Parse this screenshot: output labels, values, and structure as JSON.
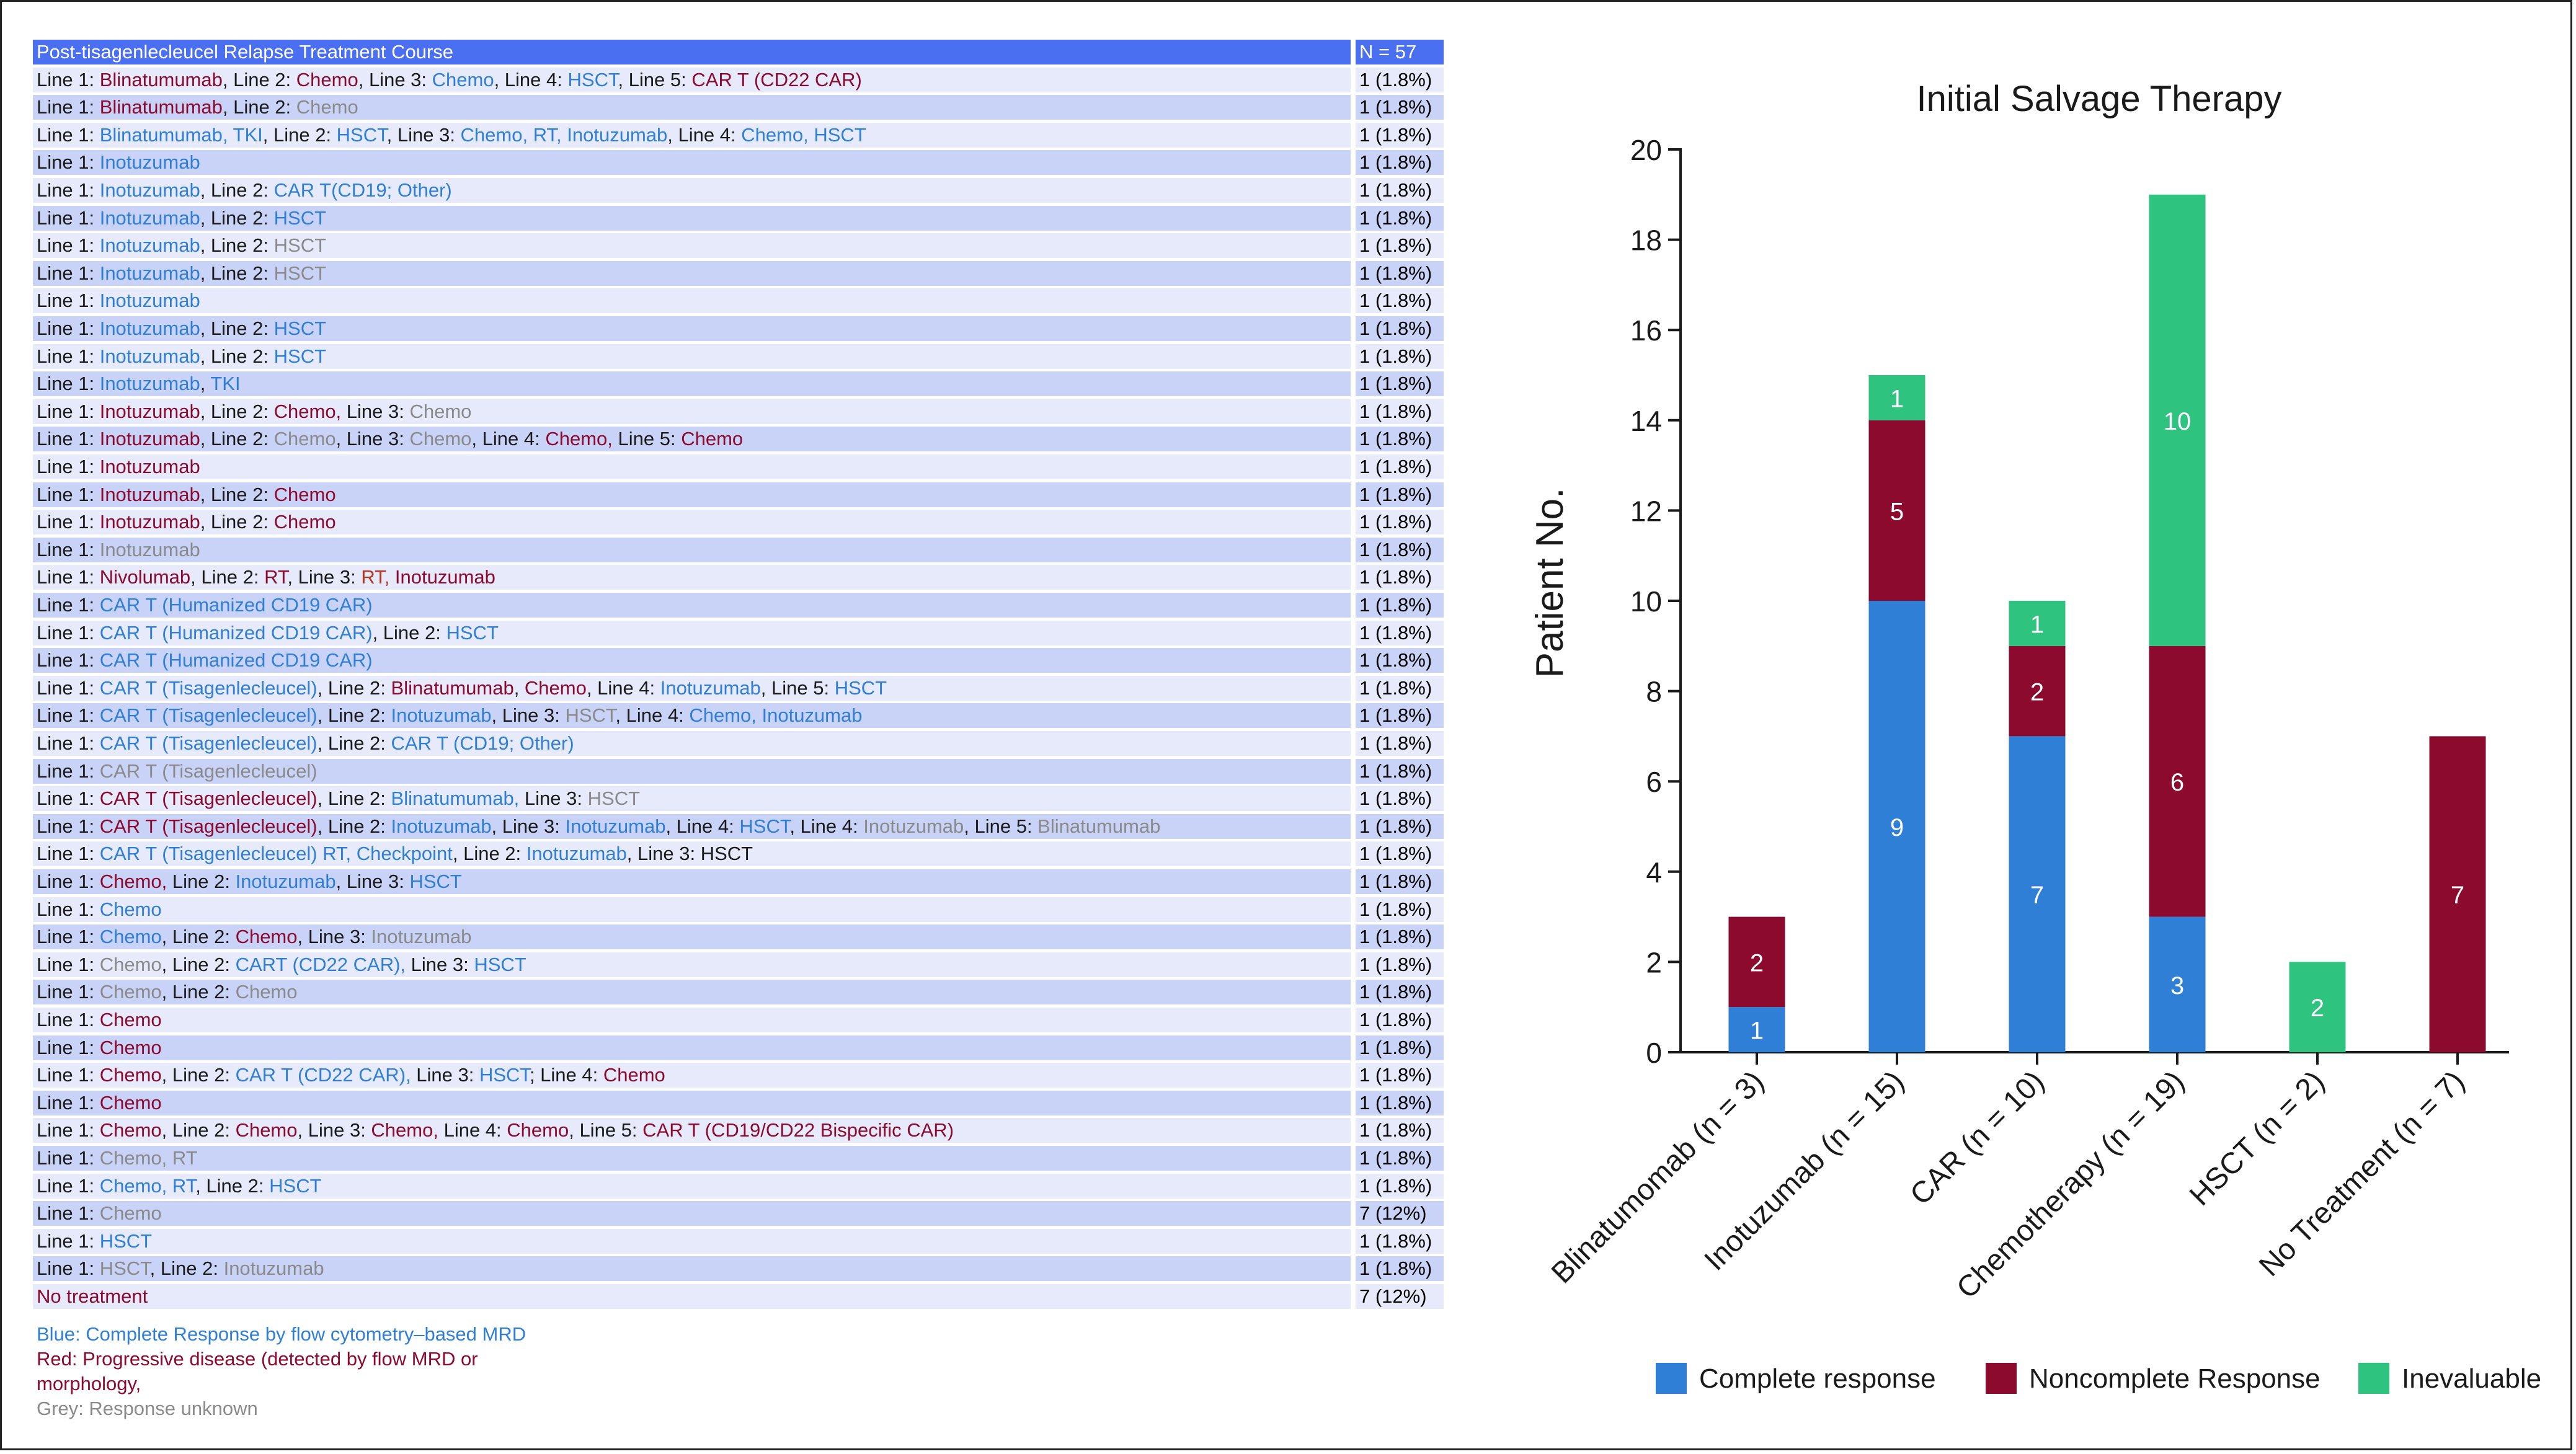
{
  "colors": {
    "blue": "#2f7fd6",
    "red": "#8b0a2e",
    "grey": "#8a8a8a",
    "orange": "#b5341c",
    "black": "#1a1a1a",
    "header": "#4a6ff0",
    "complete": "#2f7fd6",
    "noncomplete": "#8b0a2e",
    "inevaluable": "#2ec47f"
  },
  "table": {
    "header": {
      "course": "Post-tisagenlecleucel Relapse Treatment Course",
      "n": "N = 57"
    },
    "rows": [
      {
        "segs": [
          [
            "k",
            "Line 1: "
          ],
          [
            "r",
            "Blinatumumab"
          ],
          [
            "k",
            ", Line 2: "
          ],
          [
            "r",
            "Chemo"
          ],
          [
            "k",
            ", Line 3: "
          ],
          [
            "b",
            "Chemo"
          ],
          [
            "k",
            ", Line 4: "
          ],
          [
            "b",
            "HSCT"
          ],
          [
            "k",
            ", Line 5: "
          ],
          [
            "r",
            "CAR T (CD22 CAR)"
          ]
        ],
        "n": "1 (1.8%)"
      },
      {
        "segs": [
          [
            "k",
            "Line 1: "
          ],
          [
            "r",
            "Blinatumumab"
          ],
          [
            "k",
            ", Line 2: "
          ],
          [
            "g",
            "Chemo"
          ]
        ],
        "n": "1 (1.8%)"
      },
      {
        "segs": [
          [
            "k",
            "Line 1: "
          ],
          [
            "b",
            "Blinatumumab, TKI"
          ],
          [
            "k",
            ", Line 2: "
          ],
          [
            "b",
            "HSCT"
          ],
          [
            "k",
            ", Line 3: "
          ],
          [
            "b",
            "Chemo, RT, Inotuzumab"
          ],
          [
            "k",
            ", Line 4: "
          ],
          [
            "b",
            "Chemo, HSCT"
          ]
        ],
        "n": "1 (1.8%)"
      },
      {
        "segs": [
          [
            "k",
            "Line 1: "
          ],
          [
            "b",
            "Inotuzumab"
          ]
        ],
        "n": "1 (1.8%)"
      },
      {
        "segs": [
          [
            "k",
            "Line 1: "
          ],
          [
            "b",
            "Inotuzumab"
          ],
          [
            "k",
            ", Line 2: "
          ],
          [
            "b",
            "CAR T(CD19; Other)"
          ]
        ],
        "n": "1 (1.8%)"
      },
      {
        "segs": [
          [
            "k",
            "Line 1: "
          ],
          [
            "b",
            "Inotuzumab"
          ],
          [
            "k",
            ", Line 2: "
          ],
          [
            "b",
            "HSCT"
          ]
        ],
        "n": "1 (1.8%)"
      },
      {
        "segs": [
          [
            "k",
            "Line 1: "
          ],
          [
            "b",
            "Inotuzumab"
          ],
          [
            "k",
            ", Line 2: "
          ],
          [
            "g",
            "HSCT"
          ]
        ],
        "n": "1 (1.8%)"
      },
      {
        "segs": [
          [
            "k",
            "Line 1: "
          ],
          [
            "b",
            "Inotuzumab"
          ],
          [
            "k",
            ", Line 2: "
          ],
          [
            "g",
            "HSCT"
          ]
        ],
        "n": "1 (1.8%)"
      },
      {
        "segs": [
          [
            "k",
            "Line 1: "
          ],
          [
            "b",
            "Inotuzumab"
          ]
        ],
        "n": "1 (1.8%)"
      },
      {
        "segs": [
          [
            "k",
            "Line 1: "
          ],
          [
            "b",
            "Inotuzumab"
          ],
          [
            "k",
            ", Line 2: "
          ],
          [
            "b",
            "HSCT"
          ]
        ],
        "n": "1 (1.8%)"
      },
      {
        "segs": [
          [
            "k",
            "Line 1: "
          ],
          [
            "b",
            "Inotuzumab"
          ],
          [
            "k",
            ", Line 2: "
          ],
          [
            "b",
            "HSCT"
          ]
        ],
        "n": "1 (1.8%)"
      },
      {
        "segs": [
          [
            "k",
            "Line 1: "
          ],
          [
            "b",
            "Inotuzumab"
          ],
          [
            "k",
            ", "
          ],
          [
            "b",
            "TKI"
          ]
        ],
        "n": "1 (1.8%)"
      },
      {
        "segs": [
          [
            "k",
            "Line 1: "
          ],
          [
            "r",
            "Inotuzumab"
          ],
          [
            "k",
            ", Line 2: "
          ],
          [
            "r",
            "Chemo,"
          ],
          [
            "k",
            " Line 3: "
          ],
          [
            "g",
            "Chemo"
          ]
        ],
        "n": "1 (1.8%)"
      },
      {
        "segs": [
          [
            "k",
            "Line 1: "
          ],
          [
            "r",
            "Inotuzumab"
          ],
          [
            "k",
            ", Line 2: "
          ],
          [
            "g",
            "Chemo"
          ],
          [
            "k",
            ", Line 3: "
          ],
          [
            "g",
            "Chemo"
          ],
          [
            "k",
            ", Line 4: "
          ],
          [
            "r",
            "Chemo,"
          ],
          [
            "k",
            " Line 5: "
          ],
          [
            "r",
            "Chemo"
          ]
        ],
        "n": "1 (1.8%)"
      },
      {
        "segs": [
          [
            "k",
            "Line 1: "
          ],
          [
            "r",
            "Inotuzumab"
          ]
        ],
        "n": "1 (1.8%)"
      },
      {
        "segs": [
          [
            "k",
            "Line 1: "
          ],
          [
            "r",
            "Inotuzumab"
          ],
          [
            "k",
            ", Line 2: "
          ],
          [
            "r",
            "Chemo"
          ]
        ],
        "n": "1 (1.8%)"
      },
      {
        "segs": [
          [
            "k",
            "Line 1: "
          ],
          [
            "r",
            "Inotuzumab"
          ],
          [
            "k",
            ", Line 2: "
          ],
          [
            "r",
            "Chemo"
          ]
        ],
        "n": "1 (1.8%)"
      },
      {
        "segs": [
          [
            "k",
            "Line 1: "
          ],
          [
            "g",
            "Inotuzumab"
          ]
        ],
        "n": "1 (1.8%)"
      },
      {
        "segs": [
          [
            "k",
            "Line 1: "
          ],
          [
            "r",
            "Nivolumab"
          ],
          [
            "k",
            ", Line 2: "
          ],
          [
            "r",
            "RT"
          ],
          [
            "k",
            ", Line 3: "
          ],
          [
            "o",
            "RT,"
          ],
          [
            "r",
            " Inotuzumab"
          ]
        ],
        "n": "1 (1.8%)"
      },
      {
        "segs": [
          [
            "k",
            "Line 1: "
          ],
          [
            "b",
            "CAR T (Humanized CD19 CAR)"
          ]
        ],
        "n": "1 (1.8%)"
      },
      {
        "segs": [
          [
            "k",
            "Line 1: "
          ],
          [
            "b",
            "CAR T (Humanized CD19 CAR)"
          ],
          [
            "k",
            ", Line 2: "
          ],
          [
            "b",
            "HSCT"
          ]
        ],
        "n": "1 (1.8%)"
      },
      {
        "segs": [
          [
            "k",
            "Line 1: "
          ],
          [
            "b",
            "CAR T (Humanized CD19 CAR)"
          ]
        ],
        "n": "1 (1.8%)"
      },
      {
        "segs": [
          [
            "k",
            "Line 1: "
          ],
          [
            "b",
            "CAR T (Tisagenlecleucel)"
          ],
          [
            "k",
            ", Line 2: "
          ],
          [
            "r",
            "Blinatumumab"
          ],
          [
            "k",
            ", "
          ],
          [
            "r",
            "Chemo"
          ],
          [
            "k",
            ", Line 4: "
          ],
          [
            "b",
            "Inotuzumab"
          ],
          [
            "k",
            ", Line 5: "
          ],
          [
            "b",
            "HSCT"
          ]
        ],
        "n": "1 (1.8%)"
      },
      {
        "segs": [
          [
            "k",
            "Line 1: "
          ],
          [
            "b",
            "CAR T (Tisagenlecleucel)"
          ],
          [
            "k",
            ", Line 2: "
          ],
          [
            "b",
            "Inotuzumab"
          ],
          [
            "k",
            ", Line 3: "
          ],
          [
            "g",
            "HSCT"
          ],
          [
            "k",
            ", Line 4: "
          ],
          [
            "b",
            "Chemo, Inotuzumab"
          ]
        ],
        "n": "1 (1.8%)"
      },
      {
        "segs": [
          [
            "k",
            "Line 1: "
          ],
          [
            "b",
            "CAR T (Tisagenlecleucel)"
          ],
          [
            "k",
            ", Line 2: "
          ],
          [
            "b",
            "CAR T (CD19; Other)"
          ]
        ],
        "n": "1 (1.8%)"
      },
      {
        "segs": [
          [
            "k",
            "Line 1: "
          ],
          [
            "g",
            "CAR T (Tisagenlecleucel)"
          ]
        ],
        "n": "1 (1.8%)"
      },
      {
        "segs": [
          [
            "k",
            "Line 1: "
          ],
          [
            "r",
            "CAR T (Tisagenlecleucel)"
          ],
          [
            "k",
            ", Line 2: "
          ],
          [
            "b",
            "Blinatumumab,"
          ],
          [
            "k",
            " Line 3: "
          ],
          [
            "g",
            "HSCT"
          ]
        ],
        "n": "1 (1.8%)"
      },
      {
        "segs": [
          [
            "k",
            "Line 1: "
          ],
          [
            "r",
            "CAR T (Tisagenlecleucel)"
          ],
          [
            "k",
            ", Line 2: "
          ],
          [
            "b",
            "Inotuzumab"
          ],
          [
            "k",
            ", Line 3: "
          ],
          [
            "b",
            "Inotuzumab"
          ],
          [
            "k",
            ", Line 4: "
          ],
          [
            "b",
            "HSCT"
          ],
          [
            "k",
            ", Line 4: "
          ],
          [
            "g",
            "Inotuzumab"
          ],
          [
            "k",
            ", Line 5: "
          ],
          [
            "g",
            "Blinatumumab"
          ]
        ],
        "n": "1 (1.8%)"
      },
      {
        "segs": [
          [
            "k",
            "Line 1: "
          ],
          [
            "b",
            "CAR T (Tisagenlecleucel) RT, Checkpoint"
          ],
          [
            "k",
            ", Line 2: "
          ],
          [
            "b",
            "Inotuzumab"
          ],
          [
            "k",
            ", Line 3: HSCT"
          ]
        ],
        "n": "1 (1.8%)"
      },
      {
        "segs": [
          [
            "k",
            "Line 1: "
          ],
          [
            "r",
            "Chemo,"
          ],
          [
            "k",
            " Line 2: "
          ],
          [
            "b",
            "Inotuzumab"
          ],
          [
            "k",
            ", Line 3: "
          ],
          [
            "b",
            "HSCT"
          ]
        ],
        "n": "1 (1.8%)"
      },
      {
        "segs": [
          [
            "k",
            "Line 1: "
          ],
          [
            "b",
            "Chemo"
          ]
        ],
        "n": "1 (1.8%)"
      },
      {
        "segs": [
          [
            "k",
            "Line 1: "
          ],
          [
            "b",
            "Chemo"
          ],
          [
            "k",
            ", Line 2: "
          ],
          [
            "r",
            "Chemo"
          ],
          [
            "k",
            ", Line 3: "
          ],
          [
            "g",
            "Inotuzumab"
          ]
        ],
        "n": "1 (1.8%)"
      },
      {
        "segs": [
          [
            "k",
            "Line 1: "
          ],
          [
            "g",
            "Chemo"
          ],
          [
            "k",
            ", Line 2: "
          ],
          [
            "b",
            "CART (CD22 CAR),"
          ],
          [
            "k",
            " Line 3: "
          ],
          [
            "b",
            "HSCT"
          ]
        ],
        "n": "1 (1.8%)"
      },
      {
        "segs": [
          [
            "k",
            "Line 1: "
          ],
          [
            "g",
            "Chemo"
          ],
          [
            "k",
            ", Line 2: "
          ],
          [
            "g",
            "Chemo"
          ]
        ],
        "n": "1 (1.8%)"
      },
      {
        "segs": [
          [
            "k",
            "Line 1: "
          ],
          [
            "r",
            "Chemo"
          ]
        ],
        "n": "1 (1.8%)"
      },
      {
        "segs": [
          [
            "k",
            "Line 1: "
          ],
          [
            "r",
            "Chemo"
          ]
        ],
        "n": "1 (1.8%)"
      },
      {
        "segs": [
          [
            "k",
            "Line 1: "
          ],
          [
            "r",
            "Chemo"
          ],
          [
            "k",
            ", Line 2: "
          ],
          [
            "b",
            "CAR T (CD22 CAR),"
          ],
          [
            "k",
            " Line 3: "
          ],
          [
            "b",
            "HSCT"
          ],
          [
            "k",
            "; Line 4: "
          ],
          [
            "r",
            "Chemo"
          ]
        ],
        "n": "1 (1.8%)"
      },
      {
        "segs": [
          [
            "k",
            "Line 1: "
          ],
          [
            "r",
            "Chemo"
          ]
        ],
        "n": "1 (1.8%)"
      },
      {
        "segs": [
          [
            "k",
            "Line 1: "
          ],
          [
            "r",
            "Chemo"
          ],
          [
            "k",
            ", Line 2: "
          ],
          [
            "r",
            "Chemo"
          ],
          [
            "k",
            ", Line 3: "
          ],
          [
            "r",
            "Chemo,"
          ],
          [
            "k",
            " Line 4: "
          ],
          [
            "r",
            "Chemo"
          ],
          [
            "k",
            ", Line 5: "
          ],
          [
            "r",
            "CAR T (CD19/CD22 Bispecific CAR)"
          ]
        ],
        "n": "1 (1.8%)"
      },
      {
        "segs": [
          [
            "k",
            "Line 1: "
          ],
          [
            "g",
            "Chemo, RT"
          ]
        ],
        "n": "1 (1.8%)"
      },
      {
        "segs": [
          [
            "k",
            "Line 1: "
          ],
          [
            "b",
            "Chemo, RT"
          ],
          [
            "k",
            ", Line 2: "
          ],
          [
            "b",
            "HSCT"
          ]
        ],
        "n": "1 (1.8%)"
      },
      {
        "segs": [
          [
            "k",
            "Line 1: "
          ],
          [
            "g",
            "Chemo"
          ]
        ],
        "n": "7 (12%)"
      },
      {
        "segs": [
          [
            "k",
            "Line 1: "
          ],
          [
            "b",
            "HSCT"
          ]
        ],
        "n": "1 (1.8%)"
      },
      {
        "segs": [
          [
            "k",
            "Line 1: "
          ],
          [
            "g",
            "HSCT"
          ],
          [
            "k",
            ", Line 2: "
          ],
          [
            "g",
            "Inotuzumab"
          ]
        ],
        "n": "1 (1.8%)"
      },
      {
        "segs": [
          [
            "r",
            "No treatment"
          ]
        ],
        "n": "7 (12%)"
      }
    ],
    "legend": [
      {
        "color": "b",
        "text": "Blue: Complete Response by flow cytometry–based MRD"
      },
      {
        "color": "r",
        "text": "Red: Progressive disease (detected by flow MRD or"
      },
      {
        "color": "r",
        "text": "morphology,"
      },
      {
        "color": "g",
        "text": "Grey: Response unknown"
      }
    ]
  },
  "chart_data": {
    "type": "bar",
    "stacked": true,
    "title": "Initial Salvage Therapy",
    "xlabel": "",
    "ylabel": "Patient No.",
    "ylim": [
      0,
      20
    ],
    "yticks": [
      0,
      2,
      4,
      6,
      8,
      10,
      12,
      14,
      16,
      18,
      20
    ],
    "categories": [
      "Blinatumomab (n = 3)",
      "Inotuzumab (n = 15)",
      "CAR (n = 10)",
      "Chemotherapy (n = 19)",
      "HSCT (n = 2)",
      "No Treatment (n = 7)"
    ],
    "series": [
      {
        "name": "Complete response",
        "color": "#2f7fd6",
        "values": [
          1,
          10,
          7,
          3,
          0,
          0
        ],
        "labels": [
          "1",
          "9",
          "7",
          "3",
          "",
          ""
        ]
      },
      {
        "name": "Noncomplete Response",
        "color": "#8b0a2e",
        "values": [
          2,
          4,
          2,
          6,
          0,
          7
        ],
        "labels": [
          "2",
          "5",
          "2",
          "6",
          "",
          "7"
        ]
      },
      {
        "name": "Inevaluable",
        "color": "#2ec47f",
        "values": [
          0,
          1,
          1,
          10,
          2,
          0
        ],
        "labels": [
          "",
          "1",
          "1",
          "10",
          "2",
          ""
        ]
      }
    ],
    "legend_position": "bottom"
  }
}
